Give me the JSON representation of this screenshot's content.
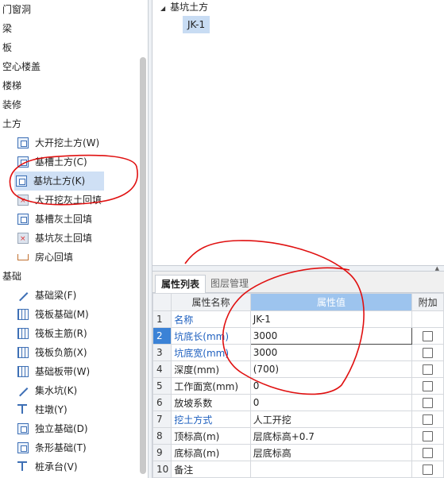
{
  "left_tree": {
    "rows": [
      {
        "label": "门窗洞",
        "kind": "cat"
      },
      {
        "label": "梁",
        "kind": "cat"
      },
      {
        "label": "板",
        "kind": "cat"
      },
      {
        "label": "空心楼盖",
        "kind": "cat"
      },
      {
        "label": "楼梯",
        "kind": "cat"
      },
      {
        "label": "装修",
        "kind": "cat"
      },
      {
        "label": "土方",
        "kind": "cat"
      },
      {
        "label": "大开挖土方(W)",
        "kind": "item",
        "icon": "excavation-icon"
      },
      {
        "label": "基槽土方(C)",
        "kind": "item",
        "icon": "trench-icon"
      },
      {
        "label": "基坑土方(K)",
        "kind": "item",
        "icon": "pit-icon",
        "selected": true
      },
      {
        "label": "大开挖灰土回填",
        "kind": "item",
        "icon": "lime-backfill-icon"
      },
      {
        "label": "基槽灰土回填",
        "kind": "item",
        "icon": "trench-backfill-icon"
      },
      {
        "label": "基坑灰土回填",
        "kind": "item",
        "icon": "pit-backfill-icon"
      },
      {
        "label": "房心回填",
        "kind": "item",
        "icon": "room-backfill-icon"
      },
      {
        "label": "基础",
        "kind": "cat"
      },
      {
        "label": "基础梁(F)",
        "kind": "item",
        "icon": "foundation-beam-icon"
      },
      {
        "label": "筏板基础(M)",
        "kind": "item",
        "icon": "raft-foundation-icon"
      },
      {
        "label": "筏板主筋(R)",
        "kind": "item",
        "icon": "raft-main-rebar-icon"
      },
      {
        "label": "筏板负筋(X)",
        "kind": "item",
        "icon": "raft-neg-rebar-icon"
      },
      {
        "label": "基础板带(W)",
        "kind": "item",
        "icon": "slab-strip-icon"
      },
      {
        "label": "集水坑(K)",
        "kind": "item",
        "icon": "sump-icon"
      },
      {
        "label": "柱墩(Y)",
        "kind": "item",
        "icon": "column-pier-icon"
      },
      {
        "label": "独立基础(D)",
        "kind": "item",
        "icon": "isolated-footing-icon"
      },
      {
        "label": "条形基础(T)",
        "kind": "item",
        "icon": "strip-footing-icon"
      },
      {
        "label": "桩承台(V)",
        "kind": "item",
        "icon": "pile-cap-icon"
      }
    ]
  },
  "component_tree": {
    "root": "基坑土方",
    "node": "JK-1"
  },
  "tabs": {
    "active": "属性列表",
    "inactive": "图层管理"
  },
  "grid": {
    "headers": {
      "name": "属性名称",
      "value": "属性值",
      "extra": "附加"
    },
    "rows": [
      {
        "n": "1",
        "name": "名称",
        "value": "JK-1",
        "blue": true,
        "checkbox": false
      },
      {
        "n": "2",
        "name": "坑底长(mm)",
        "value": "3000",
        "blue": true,
        "checkbox": true,
        "current": true
      },
      {
        "n": "3",
        "name": "坑底宽(mm)",
        "value": "3000",
        "blue": true,
        "checkbox": true
      },
      {
        "n": "4",
        "name": "深度(mm)",
        "value": "(700)",
        "blue": false,
        "checkbox": true
      },
      {
        "n": "5",
        "name": "工作面宽(mm)",
        "value": "0",
        "blue": false,
        "checkbox": true
      },
      {
        "n": "6",
        "name": "放坡系数",
        "value": "0",
        "blue": false,
        "checkbox": true
      },
      {
        "n": "7",
        "name": "挖土方式",
        "value": "人工开挖",
        "blue": true,
        "checkbox": true
      },
      {
        "n": "8",
        "name": "顶标高(m)",
        "value": "层底标高+0.7",
        "blue": false,
        "checkbox": true
      },
      {
        "n": "9",
        "name": "底标高(m)",
        "value": "层底标高",
        "blue": false,
        "checkbox": true
      },
      {
        "n": "10",
        "name": "备注",
        "value": "",
        "blue": false,
        "checkbox": true
      }
    ]
  },
  "colors": {
    "annotation": "#e01010",
    "selection": "#cfe0f5",
    "accent": "#3b82d6"
  }
}
